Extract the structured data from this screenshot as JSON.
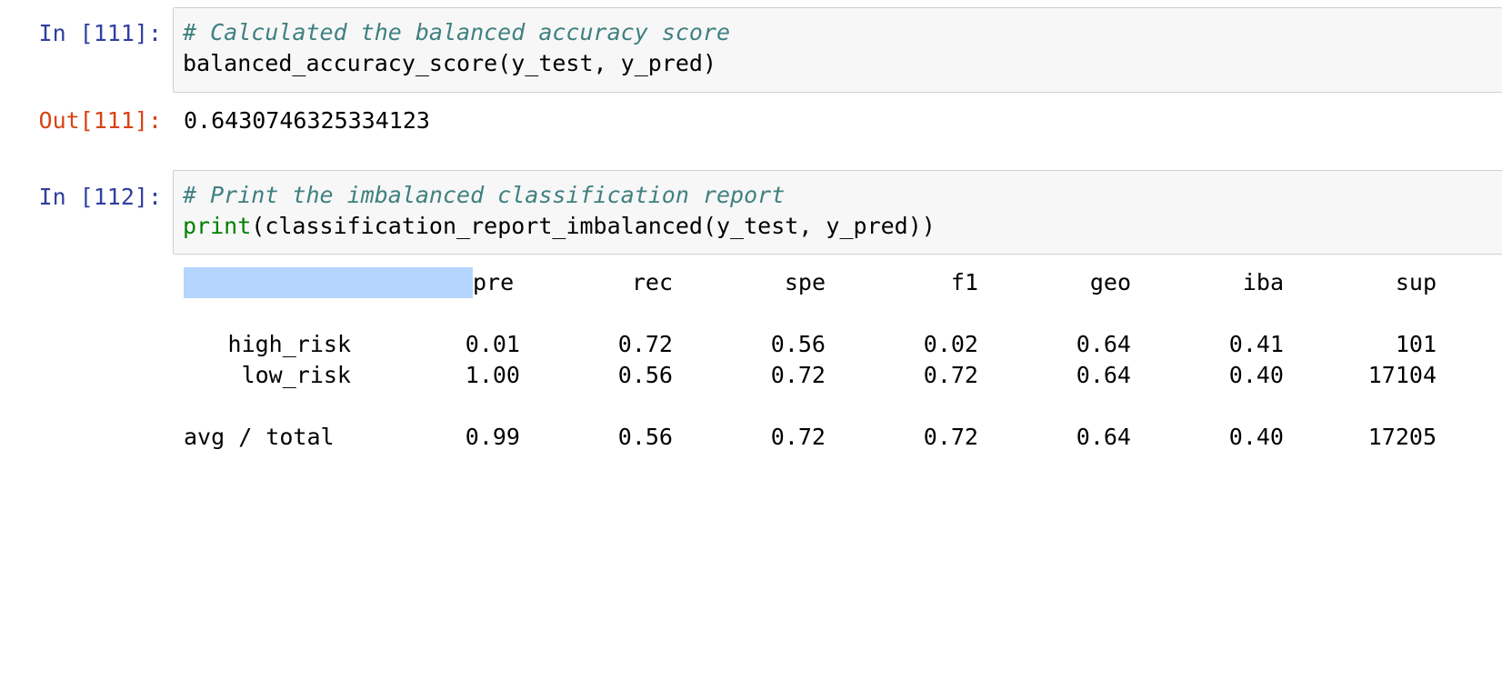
{
  "cells": [
    {
      "in_prompt": "In [111]:",
      "code": {
        "comment": "# Calculated the balanced accuracy score",
        "line2": "balanced_accuracy_score(y_test, y_pred)"
      },
      "out_prompt": "Out[111]:",
      "output": "0.6430746325334123"
    },
    {
      "in_prompt": "In [112]:",
      "code": {
        "comment": "# Print the imbalanced classification report",
        "builtin": "print",
        "line2_rest": "(classification_report_imbalanced(y_test, y_pred))"
      }
    }
  ],
  "report": {
    "headers": [
      "pre",
      "rec",
      "spe",
      "f1",
      "geo",
      "iba",
      "sup"
    ],
    "rows": [
      {
        "label": "high_risk",
        "values": [
          "0.01",
          "0.72",
          "0.56",
          "0.02",
          "0.64",
          "0.41",
          "101"
        ]
      },
      {
        "label": "low_risk",
        "values": [
          "1.00",
          "0.56",
          "0.72",
          "0.72",
          "0.64",
          "0.40",
          "17104"
        ]
      }
    ],
    "total": {
      "label": "avg / total",
      "values": [
        "0.99",
        "0.56",
        "0.72",
        "0.72",
        "0.64",
        "0.40",
        "17205"
      ]
    }
  },
  "colors": {
    "in_prompt": "#303F9F",
    "out_prompt": "#D84315",
    "comment": "#408080",
    "builtin": "#008000",
    "selection": "#b4d5fe"
  }
}
